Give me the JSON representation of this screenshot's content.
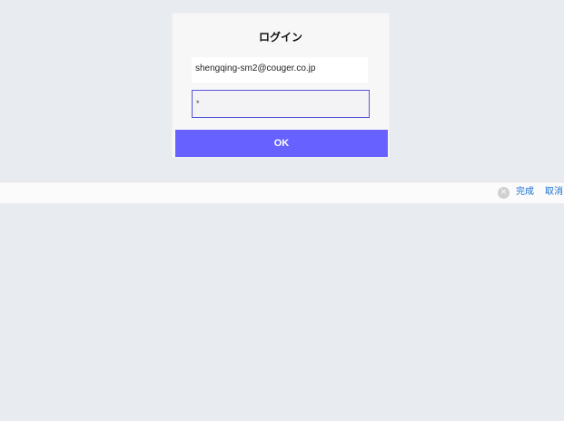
{
  "login": {
    "title": "ログイン",
    "email_value": "shengqing-sm2@couger.co.jp",
    "password_value": "*",
    "ok_label": "OK"
  },
  "accessory": {
    "clear_icon": "×",
    "done_label": "完成",
    "cancel_label": "取消"
  },
  "colors": {
    "background": "#e8ecf0",
    "accent": "#6661ff",
    "link": "#1a6fd1"
  }
}
